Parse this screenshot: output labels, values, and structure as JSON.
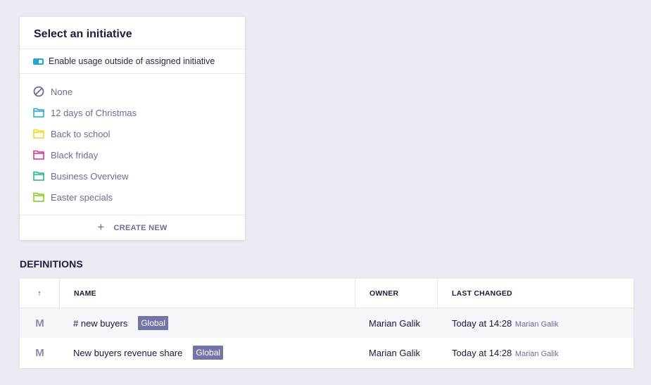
{
  "popup": {
    "title": "Select an initiative",
    "toggle_label": "Enable usage outside of assigned initiative",
    "toggle_color": "#22a8cf",
    "items": [
      {
        "label": "None",
        "icon": "no-entry-icon",
        "color": "#6d6d96"
      },
      {
        "label": "12 days of Christmas",
        "icon": "folder-icon",
        "color": "#22a8cf"
      },
      {
        "label": "Back to school",
        "icon": "folder-icon",
        "color": "#fbd318"
      },
      {
        "label": "Black friday",
        "icon": "folder-icon",
        "color": "#d62f80"
      },
      {
        "label": "Business Overview",
        "icon": "folder-icon",
        "color": "#13b58f"
      },
      {
        "label": "Easter specials",
        "icon": "folder-icon",
        "color": "#82cc19"
      }
    ],
    "create_icon": "+",
    "create_label": "CREATE NEW"
  },
  "definitions": {
    "title": "DEFINITIONS",
    "columns": {
      "sort_icon": "↑",
      "name": "NAME",
      "owner": "OWNER",
      "last_changed": "LAST CHANGED"
    },
    "rows": [
      {
        "icon": "M",
        "name": "# new buyers",
        "badge": "Global",
        "owner": "Marian Galik",
        "changed": "Today at 14:28",
        "changed_by": "Marian Galik"
      },
      {
        "icon": "M",
        "name": "New buyers revenue share",
        "badge": "Global",
        "owner": "Marian Galik",
        "changed": "Today at 14:28",
        "changed_by": "Marian Galik"
      }
    ]
  }
}
